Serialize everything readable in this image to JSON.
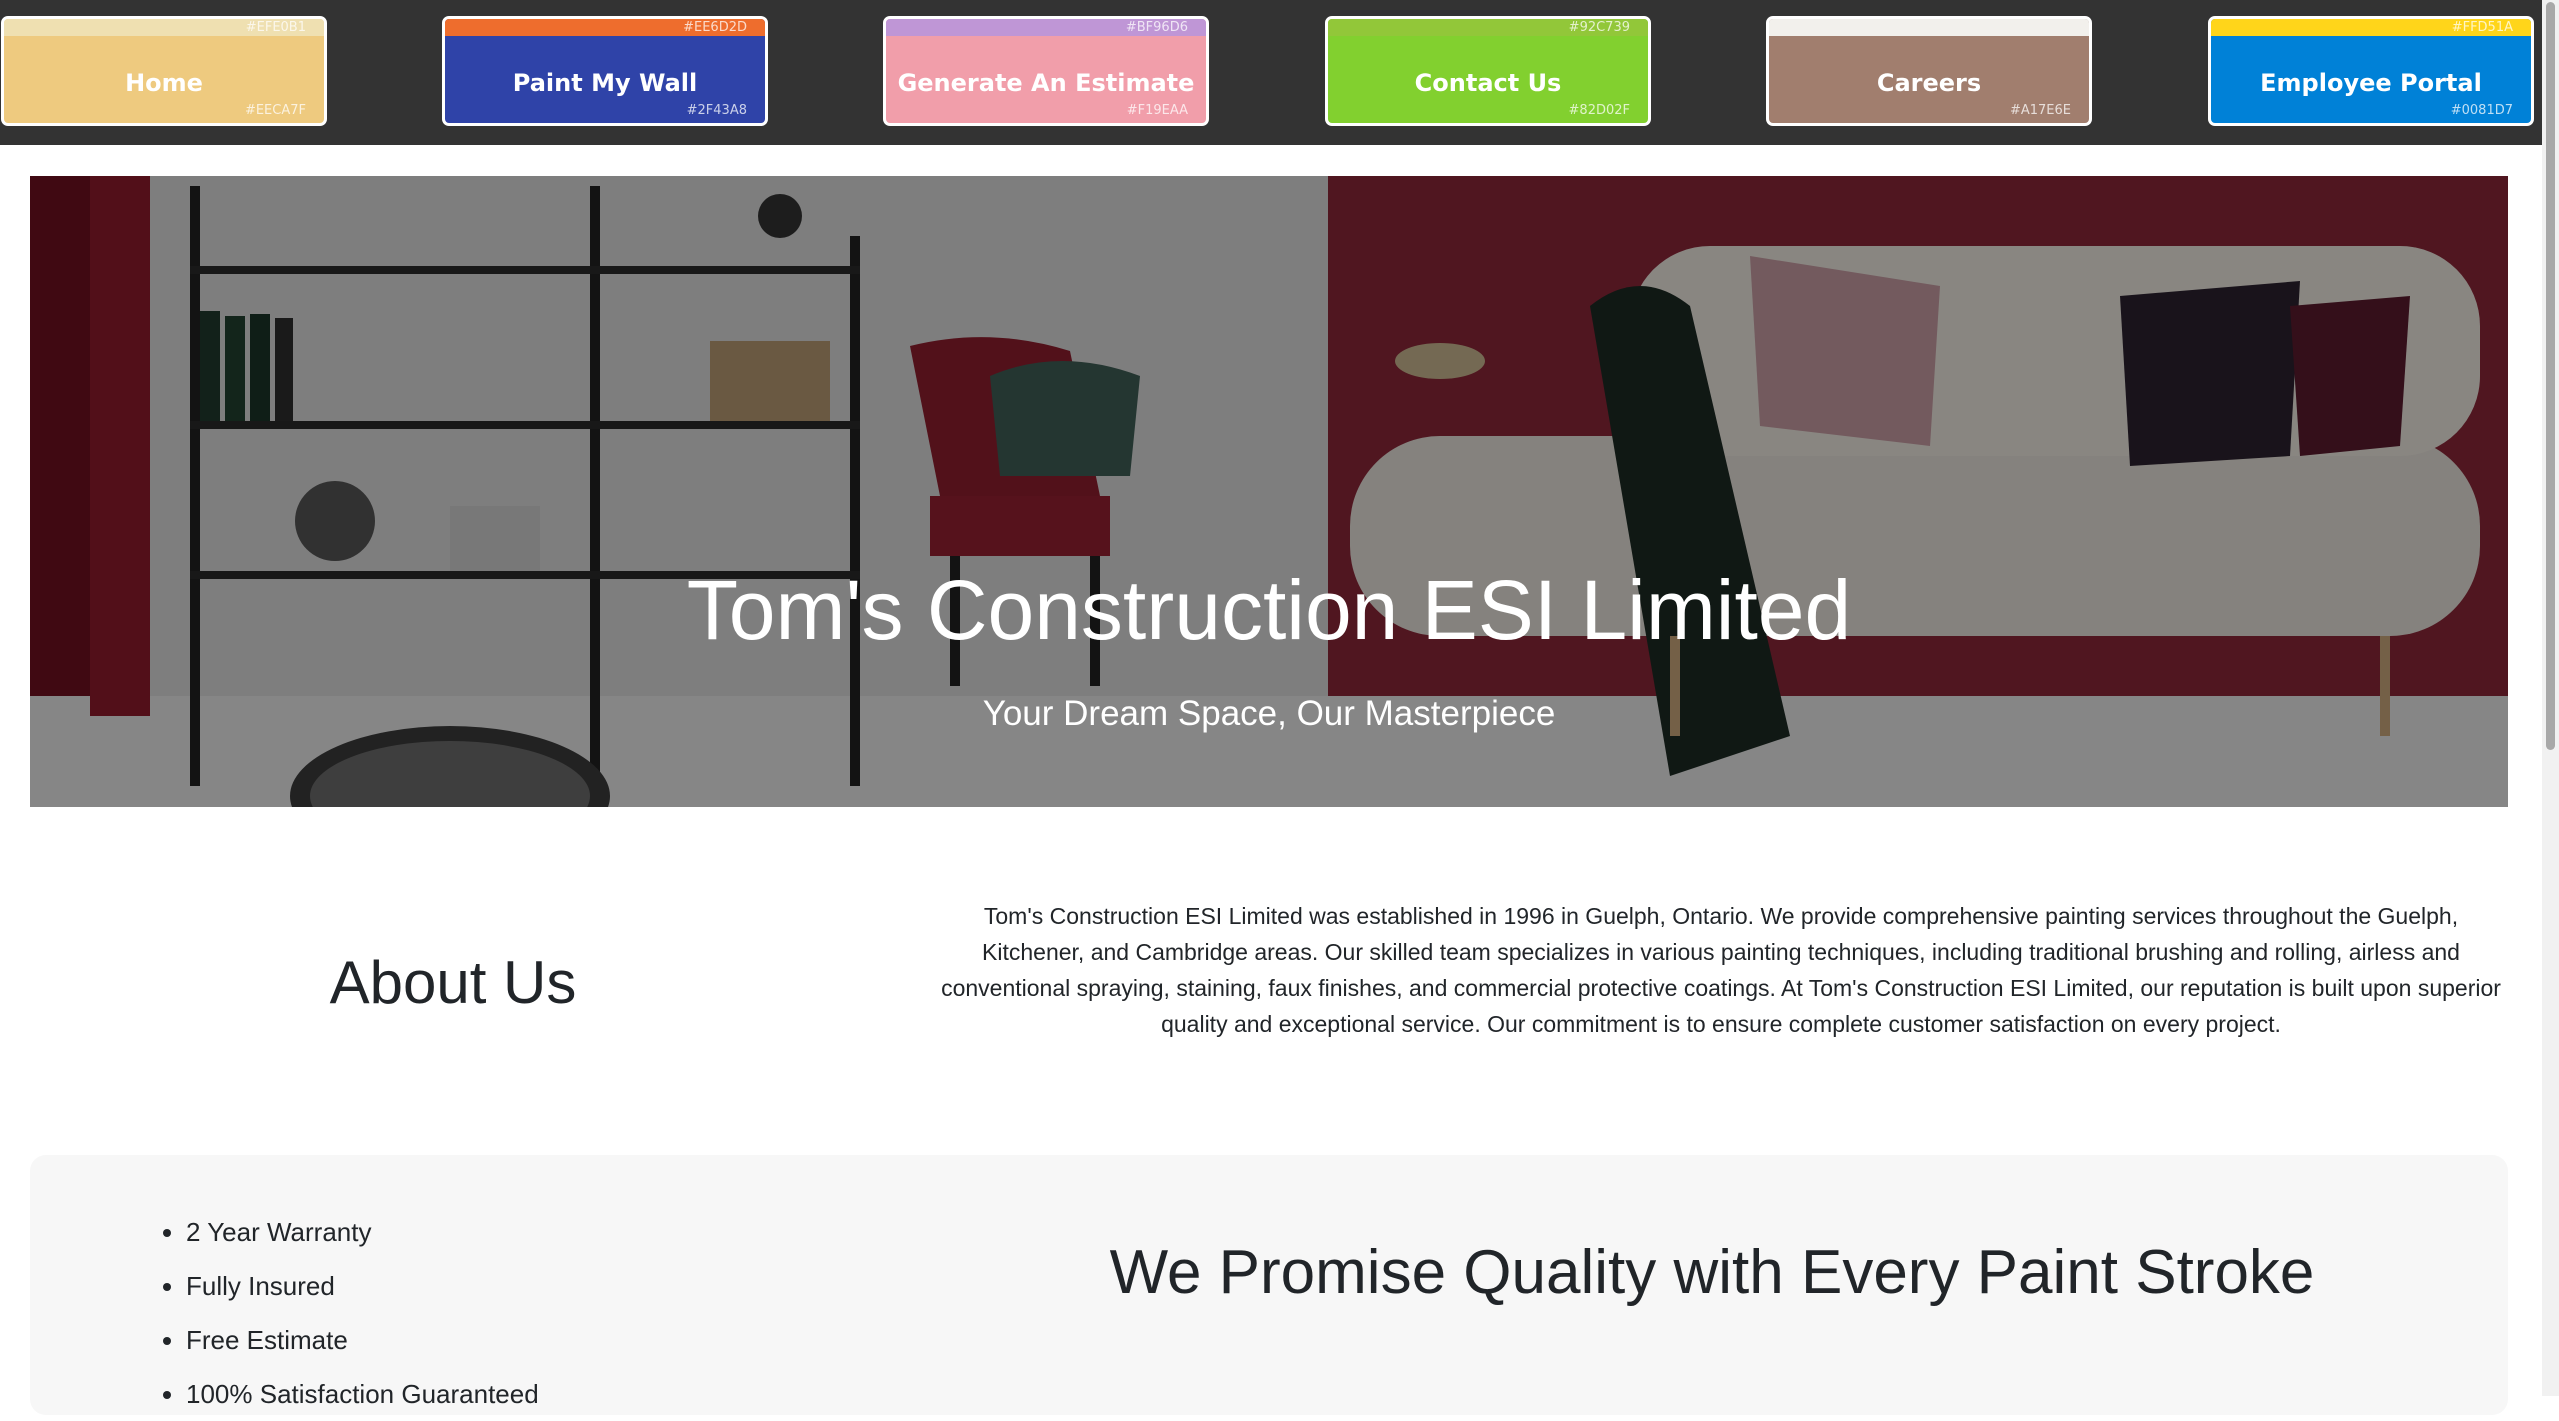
{
  "nav": [
    {
      "label": "Home",
      "hex_top": "#EFE0B1",
      "hex_bottom": "#EECA7F",
      "top_color": "#EFE0B1",
      "bg_color": "#EECA7F"
    },
    {
      "label": "Paint My Wall",
      "hex_top": "#EE6D2D",
      "hex_bottom": "#2F43A8",
      "top_color": "#EE6D2D",
      "bg_color": "#2F43A8"
    },
    {
      "label": "Generate An Estimate",
      "hex_top": "#BF96D6",
      "hex_bottom": "#F19EAA",
      "top_color": "#BF96D6",
      "bg_color": "#F19EAA"
    },
    {
      "label": "Contact Us",
      "hex_top": "#92C739",
      "hex_bottom": "#82D02F",
      "top_color": "#92C739",
      "bg_color": "#82D02F"
    },
    {
      "label": "Careers",
      "hex_top": "",
      "hex_bottom": "#A17E6E",
      "top_color": "#F2F0EC",
      "bg_color": "#A17E6E"
    },
    {
      "label": "Employee Portal",
      "hex_top": "#FFD51A",
      "hex_bottom": "#0081D7",
      "top_color": "#FFD51A",
      "bg_color": "#0081D7"
    }
  ],
  "hero": {
    "title": "Tom's Construction ESI Limited",
    "subtitle": "Your Dream Space, Our Masterpiece"
  },
  "about": {
    "heading": "About Us",
    "text": "Tom's Construction ESI Limited was established in 1996 in Guelph, Ontario. We provide comprehensive painting services throughout the Guelph, Kitchener, and Cambridge areas. Our skilled team specializes in various painting techniques, including traditional brushing and rolling, airless and conventional spraying, staining, faux finishes, and commercial protective coatings. At Tom's Construction ESI Limited, our reputation is built upon superior quality and exceptional service. Our commitment is to ensure complete customer satisfaction on every project."
  },
  "features": {
    "items": [
      "2 Year Warranty",
      "Fully Insured",
      "Free Estimate",
      "100% Satisfaction Guaranteed"
    ],
    "heading": "We Promise Quality with Every Paint Stroke"
  }
}
